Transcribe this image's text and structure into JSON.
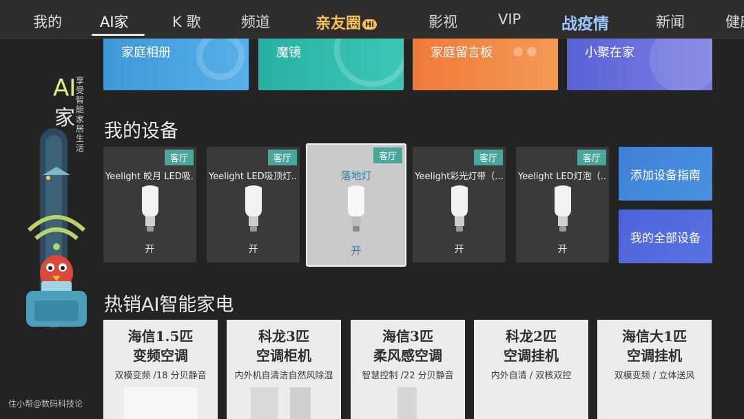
{
  "nav": {
    "items": [
      "我的",
      "AI家",
      "K 歌",
      "频道",
      "影视",
      "VIP",
      "新闻",
      "健康"
    ],
    "logo": "亲友圈",
    "logo_badge": "Hi",
    "special": "战疫情"
  },
  "side": {
    "ai": "AI",
    "jia": "家",
    "slogan": "享受智能家居生活"
  },
  "features": [
    "家庭相册",
    "魔镜",
    "家庭留言板",
    "小聚在家"
  ],
  "sections": {
    "devices_title": "我的设备",
    "products_title": "热销AI智能家电"
  },
  "devices": [
    {
      "room": "客厅",
      "name": "Yeelight 皎月 LED吸...",
      "state": "开"
    },
    {
      "room": "客厅",
      "name": "Yeelight LED吸顶灯...",
      "state": "开"
    },
    {
      "room": "客厅",
      "name": "落地灯",
      "state": "开"
    },
    {
      "room": "客厅",
      "name": "Yeelight彩光灯带（...",
      "state": "开"
    },
    {
      "room": "客厅",
      "name": "Yeelight LED灯泡（...",
      "state": "开"
    }
  ],
  "device_actions": {
    "guide": "添加设备指南",
    "all": "我的全部设备"
  },
  "products": [
    {
      "line1": "海信1.5匹",
      "line2": "变频空调",
      "desc": "双模变频 /18 分贝静音"
    },
    {
      "line1": "科龙3匹",
      "line2": "空调柜机",
      "desc": "内外机自清洁自然风除湿"
    },
    {
      "line1": "海信3匹",
      "line2": "柔风感空调",
      "desc": "智慧控制 /22 分贝静音"
    },
    {
      "line1": "科龙2匹",
      "line2": "空调挂机",
      "desc": "内外自清 / 双核双控"
    },
    {
      "line1": "海信大1匹",
      "line2": "空调挂机",
      "desc": "双模变频 / 立体送风"
    }
  ],
  "watermark": "住小帮@数码科技论",
  "colors": {
    "room_tag": "#4aa59a",
    "focused_text": "#2f7fa4",
    "action_blue_1": "#3d7fd6",
    "action_blue_2": "#4b63d9"
  }
}
